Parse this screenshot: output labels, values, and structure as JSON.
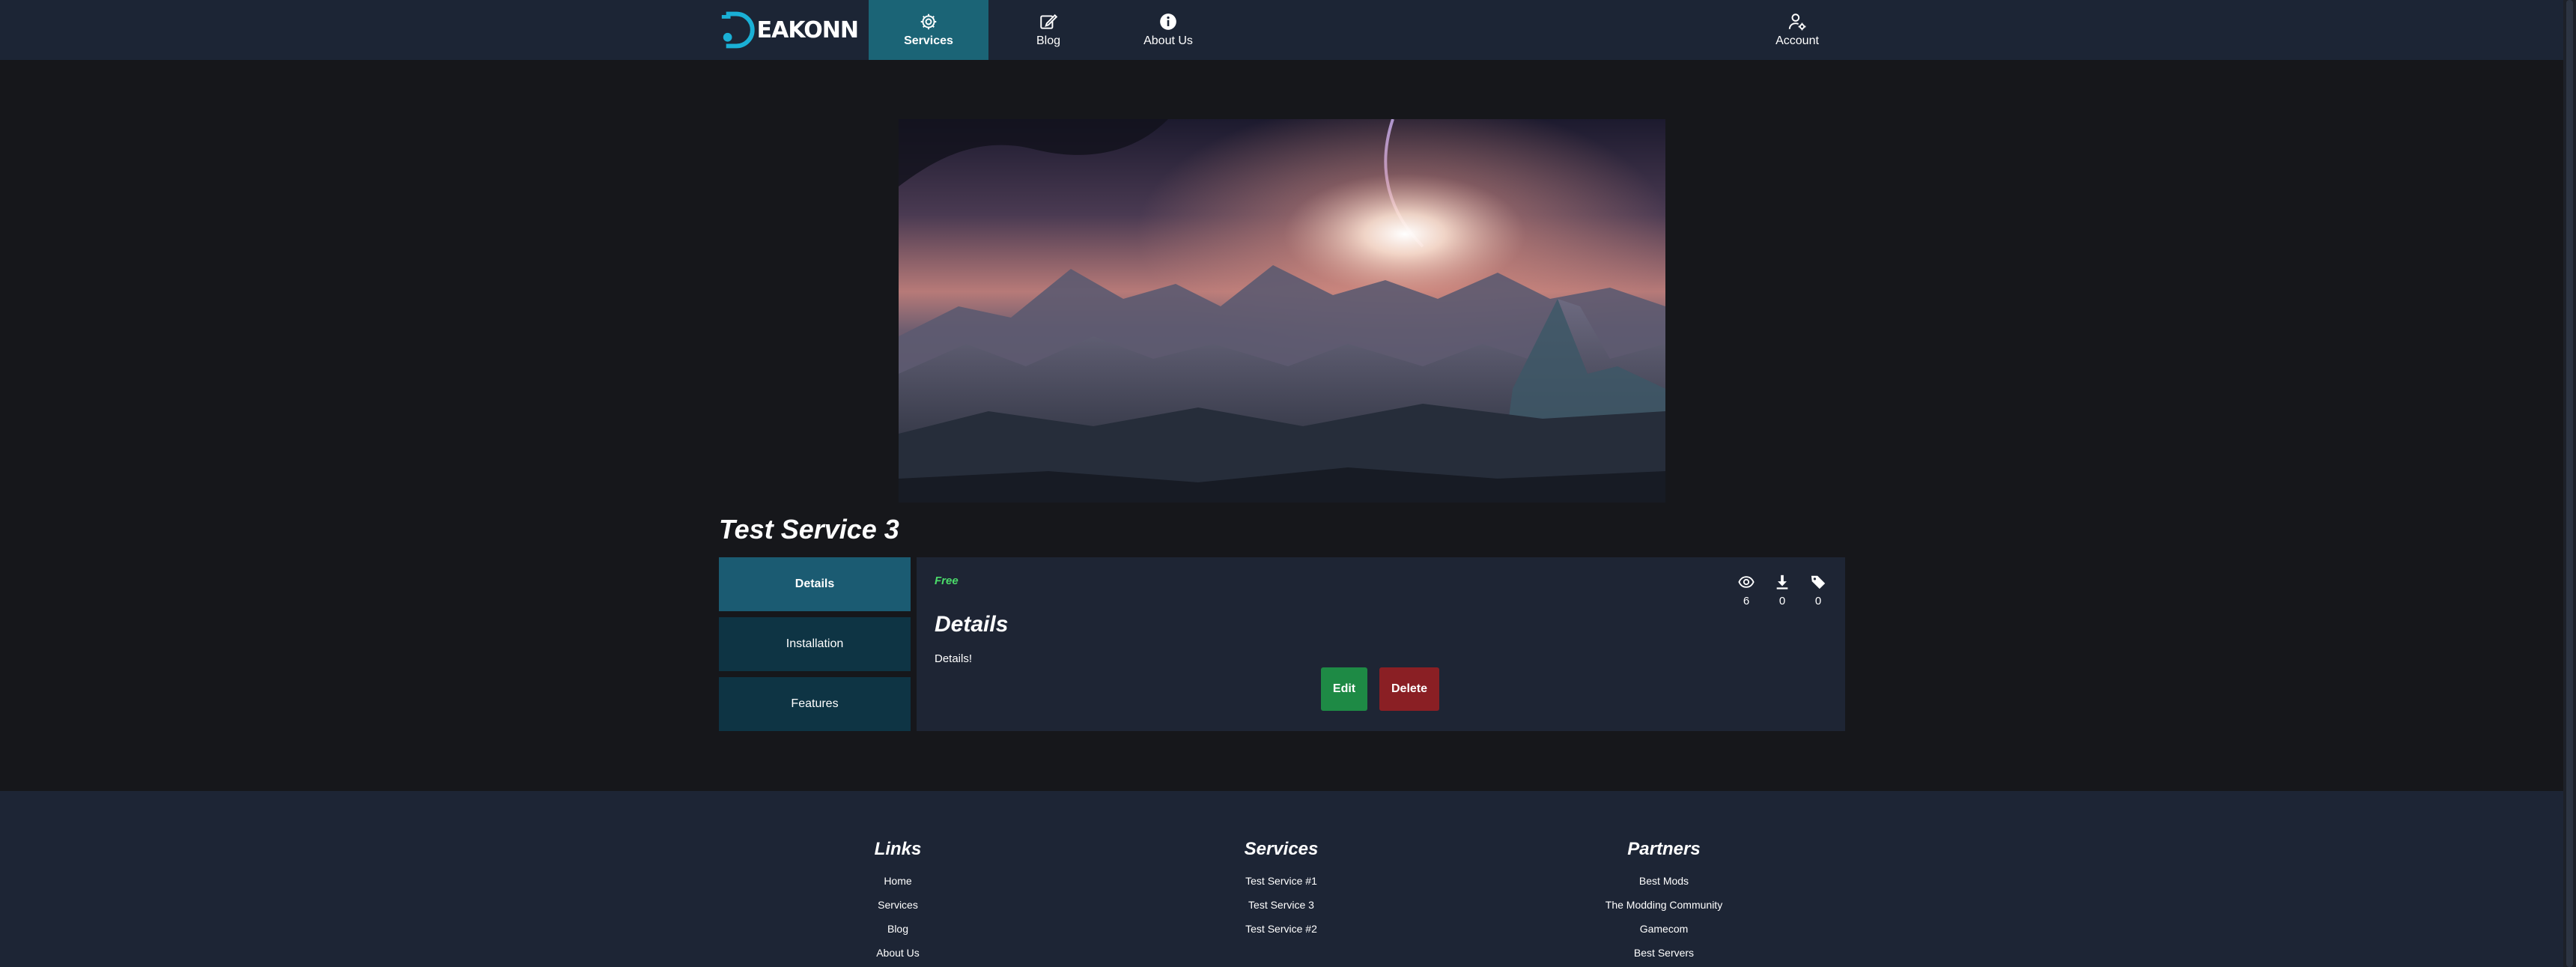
{
  "nav": {
    "logo_text": "EAKONN",
    "items": [
      {
        "label": "Services",
        "icon": "gear-icon",
        "active": true
      },
      {
        "label": "Blog",
        "icon": "edit-icon"
      },
      {
        "label": "About Us",
        "icon": "info-icon"
      }
    ],
    "account": {
      "label": "Account",
      "icon": "user-gear-icon"
    }
  },
  "hero": {
    "alt": "Alien planet landscape with glowing sun over mountains"
  },
  "service": {
    "title": "Test Service 3",
    "tabs": [
      {
        "label": "Details",
        "active": true
      },
      {
        "label": "Installation"
      },
      {
        "label": "Features"
      }
    ],
    "price": "Free",
    "stats": {
      "views": "6",
      "downloads": "0",
      "tags": "0"
    },
    "section_heading": "Details",
    "section_text": "Details!",
    "edit_label": "Edit",
    "delete_label": "Delete"
  },
  "footer": {
    "links": {
      "title": "Links",
      "items": [
        "Home",
        "Services",
        "Blog",
        "About Us"
      ]
    },
    "services": {
      "title": "Services",
      "items": [
        "Test Service #1",
        "Test Service 3",
        "Test Service #2"
      ]
    },
    "partners": {
      "title": "Partners",
      "items": [
        "Best Mods",
        "The Modding Community",
        "Gamecom",
        "Best Servers"
      ]
    }
  },
  "colors": {
    "navbar": "#1c2535",
    "active_nav": "#1b6476",
    "background": "#16171b",
    "panel": "#1e2534",
    "tab": "#0e3444",
    "tab_active": "#1b5b72",
    "price": "#4bdc6a",
    "edit_button": "#1e8a45",
    "delete_button": "#8a1f24"
  }
}
